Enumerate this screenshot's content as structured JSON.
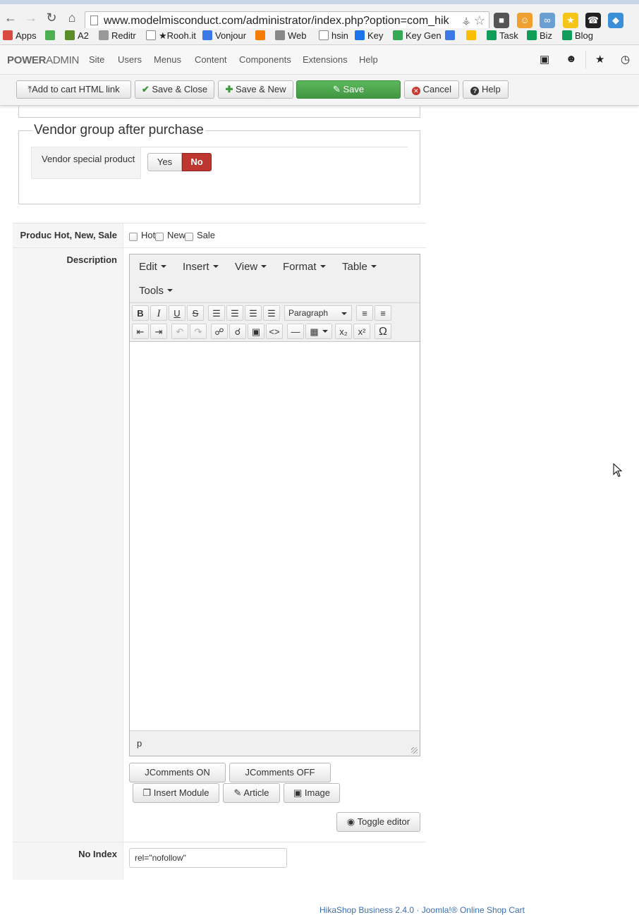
{
  "browser": {
    "url_main": "www.modelmisconduct.com/administrator/index.php?option=com_hik",
    "url_scheme_hidden": "",
    "bookmarks": [
      {
        "label": "Apps",
        "color": "#d94b3f"
      },
      {
        "label": "",
        "color": "#4caf50"
      },
      {
        "label": "A2",
        "color": "#5b8c2a"
      },
      {
        "label": "Reditr",
        "color": "#999999"
      },
      {
        "label": "★Rooh.it",
        "color": "#ffffff"
      },
      {
        "label": "Vonjour",
        "color": "#3b78e7"
      },
      {
        "label": "",
        "color": "#f57c00"
      },
      {
        "label": "Web",
        "color": "#888888"
      },
      {
        "label": "hsin",
        "color": "#ffffff"
      },
      {
        "label": "Key",
        "color": "#1a73e8"
      },
      {
        "label": "Key Gen",
        "color": "#34a853"
      },
      {
        "label": "",
        "color": "#3b78e7"
      },
      {
        "label": "",
        "color": "#fbbc04"
      },
      {
        "label": "Task",
        "color": "#0f9d58"
      },
      {
        "label": "Biz",
        "color": "#0f9d58"
      },
      {
        "label": "Blog",
        "color": "#0f9d58"
      }
    ]
  },
  "adminbar": {
    "brand_bold": "POWER",
    "brand_light": "ADMIN",
    "menu": [
      "Site",
      "Users",
      "Menus",
      "Content",
      "Components",
      "Extensions",
      "Help"
    ]
  },
  "toolbar": {
    "add_to_cart": "Add to cart HTML link",
    "save_close": "Save & Close",
    "save_new": "Save & New",
    "save": "Save",
    "cancel": "Cancel",
    "help": "Help"
  },
  "vendor": {
    "legend": "Vendor group after purchase",
    "special_label": "Vendor special product",
    "yes": "Yes",
    "no": "No",
    "selected": "No"
  },
  "fields": {
    "hot_new_sale_label": "Produc Hot, New, Sale",
    "hot": "Hot",
    "new": "New",
    "sale": "Sale",
    "description_label": "Description",
    "no_index_label": "No Index",
    "no_index_value": "rel=\"nofollow\""
  },
  "editor": {
    "menus": [
      "Edit",
      "Insert",
      "View",
      "Format",
      "Table",
      "Tools"
    ],
    "block_format": "Paragraph",
    "path": "p"
  },
  "below_editor": {
    "jcomments_on": "JComments ON",
    "jcomments_off": "JComments OFF",
    "insert_module": "Insert Module",
    "article": "Article",
    "image": "Image",
    "toggle_editor": "Toggle editor"
  },
  "footer": {
    "text": "HikaShop Business 2.4.0 · Joomla!® Online Shop Cart"
  }
}
